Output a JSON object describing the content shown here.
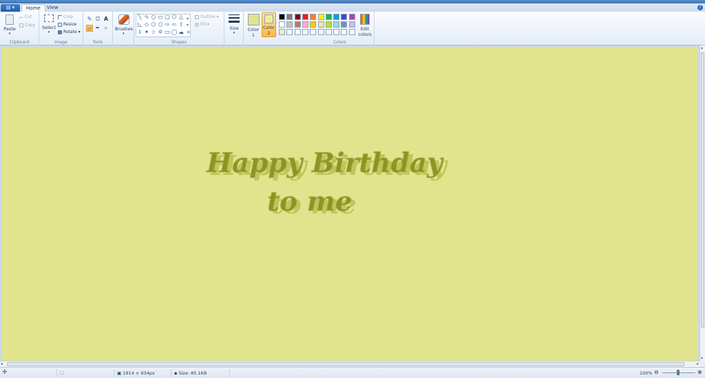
{
  "tabs": [
    {
      "label": "Home",
      "active": true
    },
    {
      "label": "View",
      "active": false
    }
  ],
  "ribbon": {
    "clipboard": {
      "paste": "Paste",
      "cut": "Cut",
      "copy": "Copy",
      "caption": "Clipboard"
    },
    "image": {
      "select": "Select",
      "crop": "Crop",
      "resize": "Resize",
      "rotate": "Rotate",
      "caption": "Image"
    },
    "tools": {
      "caption": "Tools"
    },
    "brushes": {
      "label": "Brushes"
    },
    "shapes": {
      "outline": "Outline",
      "fill": "Fill",
      "caption": "Shapes"
    },
    "size": {
      "label": "Size"
    },
    "colors": {
      "color1_line1": "Color",
      "color1_line2": "1",
      "color2_line1": "Color",
      "color2_line2": "2",
      "edit_line1": "Edit",
      "edit_line2": "colors",
      "caption": "Colors",
      "color1": "#e0e48d",
      "color2": "#eded9d",
      "palette_row1": [
        "#000000",
        "#7f7f7f",
        "#880015",
        "#ed1c24",
        "#ff7f27",
        "#fff200",
        "#22b14c",
        "#00a2e8",
        "#3f48cc",
        "#a349a4"
      ],
      "palette_row2": [
        "#ffffff",
        "#c3c3c3",
        "#b97a57",
        "#ffaec9",
        "#ffc90e",
        "#efe4b0",
        "#b5e61d",
        "#99d9ea",
        "#7092be",
        "#c8bfe7"
      ],
      "palette_row3": [
        "#f3ecb8",
        "#f7f7f7",
        "#f7f7f7",
        "#f7f7f7",
        "#f7f7f7",
        "#f7f7f7",
        "#f7f7f7",
        "#f7f7f7",
        "#f7f7f7",
        "#f7f7f7"
      ]
    }
  },
  "canvas": {
    "background": "#e0e48d",
    "text_line1": "Happy Birthday",
    "text_line2": "to me",
    "text_color": "#8e9323"
  },
  "status": {
    "dimensions": "1914 × 934px",
    "size": "Size: 85.1KB",
    "zoom": "100%"
  }
}
